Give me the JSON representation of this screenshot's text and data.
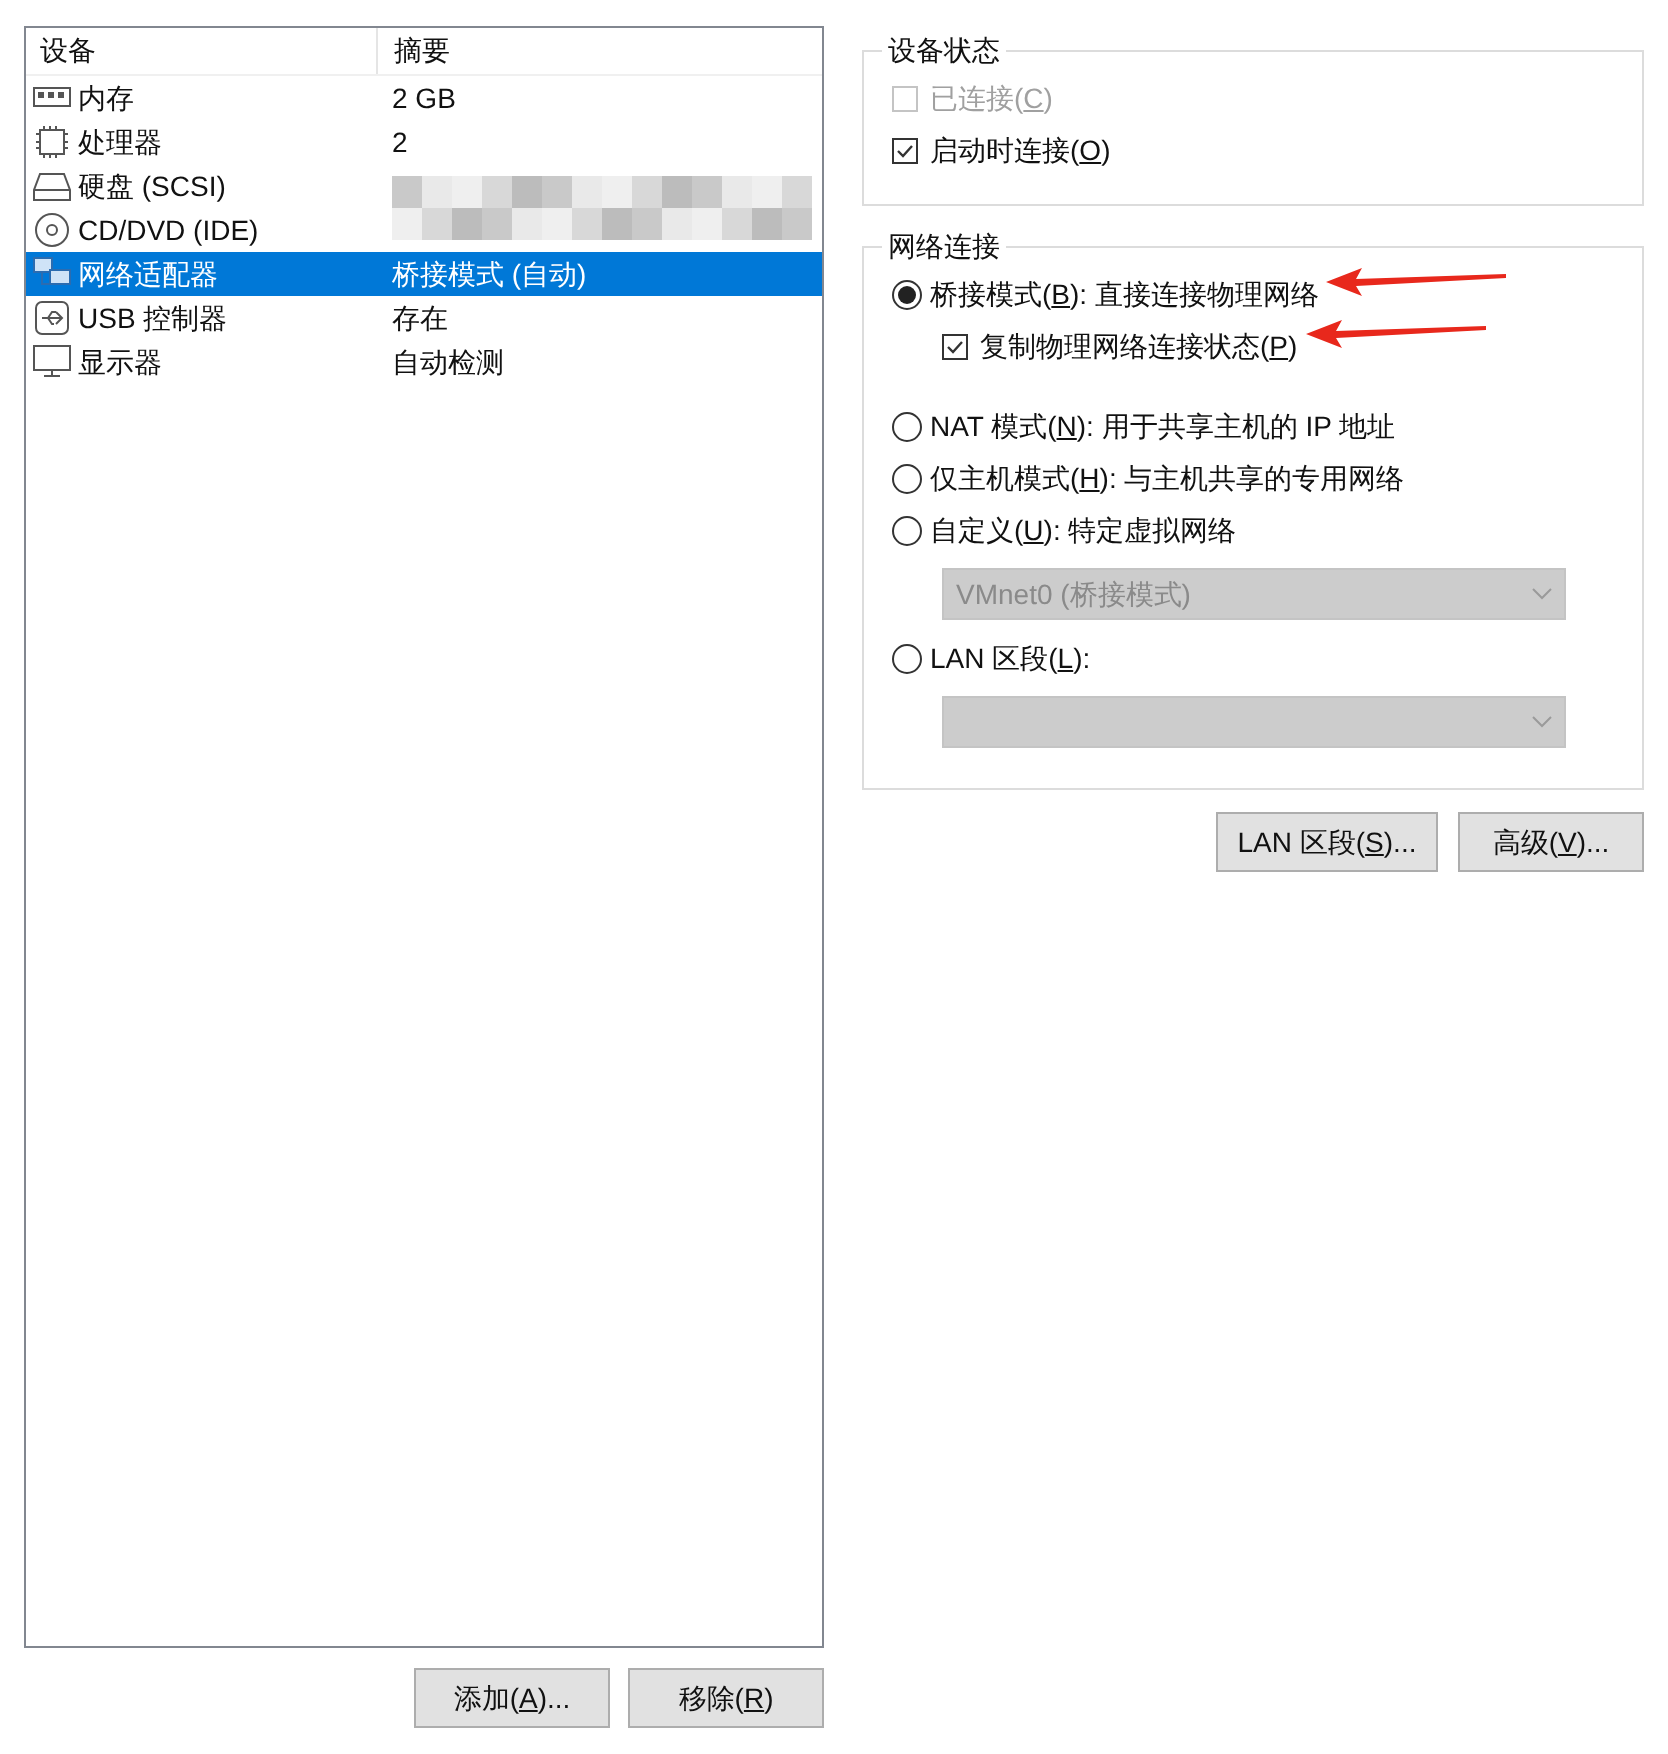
{
  "device_list": {
    "columns": [
      "设备",
      "摘要"
    ],
    "rows": [
      {
        "kind": "memory",
        "name": "内存",
        "summary": "2 GB",
        "selected": false,
        "redacted": false
      },
      {
        "kind": "cpu",
        "name": "处理器",
        "summary": "2",
        "selected": false,
        "redacted": false
      },
      {
        "kind": "disk",
        "name": "硬盘 (SCSI)",
        "selected": false,
        "redacted": true
      },
      {
        "kind": "cd",
        "name": "CD/DVD (IDE)",
        "selected": false,
        "redacted": true
      },
      {
        "kind": "network",
        "name": "网络适配器",
        "summary": "桥接模式 (自动)",
        "selected": true,
        "redacted": false
      },
      {
        "kind": "usb",
        "name": "USB 控制器",
        "summary": "存在",
        "selected": false,
        "redacted": false
      },
      {
        "kind": "display",
        "name": "显示器",
        "summary": "自动检测",
        "selected": false,
        "redacted": false
      }
    ]
  },
  "left_buttons": [
    {
      "before": "添加(",
      "key": "A",
      "after": ")..."
    },
    {
      "before": "移除(",
      "key": "R",
      "after": ")"
    }
  ],
  "device_status": {
    "title": "设备状态",
    "options": [
      {
        "before": "已连接(",
        "key": "C",
        "after": ")",
        "checked": false,
        "disabled": true
      },
      {
        "before": "启动时连接(",
        "key": "O",
        "after": ")",
        "checked": true,
        "disabled": false
      }
    ]
  },
  "network_connection": {
    "title": "网络连接",
    "items": [
      {
        "kind": "radio",
        "before": "桥接模式(",
        "key": "B",
        "after": "): 直接连接物理网络",
        "selected": true,
        "arrow": true
      },
      {
        "kind": "checkbox",
        "before": "复制物理网络连接状态(",
        "key": "P",
        "after": ")",
        "checked": true,
        "arrow": true
      },
      {
        "kind": "radio",
        "before": "NAT 模式(",
        "key": "N",
        "after": "): 用于共享主机的 IP 地址",
        "selected": false,
        "arrow": false
      },
      {
        "kind": "radio",
        "before": "仅主机模式(",
        "key": "H",
        "after": "): 与主机共享的专用网络",
        "selected": false,
        "arrow": false
      },
      {
        "kind": "radio",
        "before": "自定义(",
        "key": "U",
        "after": "): 特定虚拟网络",
        "selected": false,
        "arrow": false
      },
      {
        "kind": "select",
        "value": "VMnet0 (桥接模式)",
        "disabled": true
      },
      {
        "kind": "radio",
        "before": "LAN 区段(",
        "key": "L",
        "after": "):",
        "selected": false,
        "arrow": false
      },
      {
        "kind": "select",
        "disabled": true
      }
    ]
  },
  "right_buttons": [
    {
      "before": "LAN 区段(",
      "key": "S",
      "after": ")..."
    },
    {
      "before": "高级(",
      "key": "V",
      "after": ")..."
    }
  ]
}
